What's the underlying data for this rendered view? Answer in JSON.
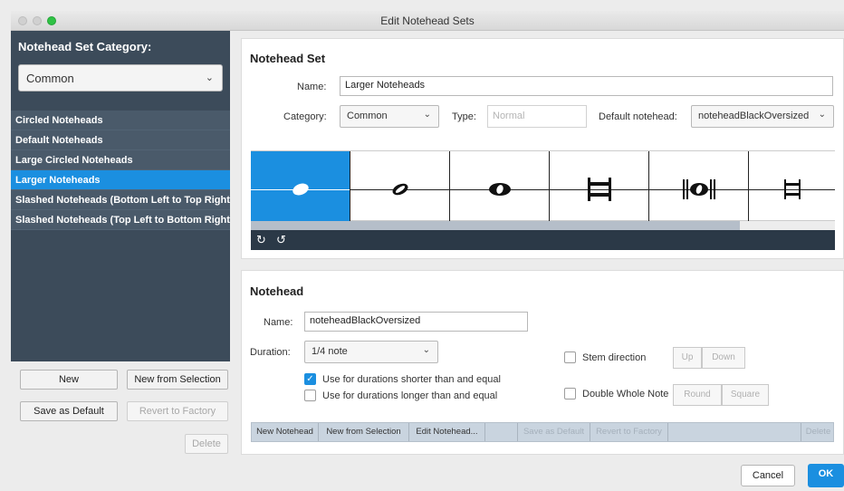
{
  "window": {
    "title": "Edit Notehead Sets"
  },
  "sidebar": {
    "category_label": "Notehead Set Category:",
    "category_value": "Common",
    "items": [
      {
        "label": "Circled Noteheads",
        "selected": false
      },
      {
        "label": "Default Noteheads",
        "selected": false
      },
      {
        "label": "Large Circled Noteheads",
        "selected": false
      },
      {
        "label": "Larger Noteheads",
        "selected": true
      },
      {
        "label": "Slashed Noteheads (Bottom Left to Top Right)",
        "selected": false
      },
      {
        "label": "Slashed Noteheads (Top Left to Bottom Right)",
        "selected": false
      }
    ],
    "buttons": {
      "new": "New",
      "new_from_selection": "New from Selection",
      "save_as_default": "Save as Default",
      "revert_to_factory": "Revert to Factory",
      "delete": "Delete"
    }
  },
  "notehead_set": {
    "title": "Notehead Set",
    "name_label": "Name:",
    "name_value": "Larger Noteheads",
    "category_label": "Category:",
    "category_value": "Common",
    "type_label": "Type:",
    "type_value": "Normal",
    "default_label": "Default notehead:",
    "default_value": "noteheadBlackOversized"
  },
  "notehead": {
    "title": "Notehead",
    "name_label": "Name:",
    "name_value": "noteheadBlackOversized",
    "duration_label": "Duration:",
    "duration_value": "1/4 note",
    "shorter_label": "Use for durations shorter than and equal",
    "longer_label": "Use for durations longer than and equal",
    "stem_label": "Stem direction",
    "stem_up": "Up",
    "stem_down": "Down",
    "dwn_label": "Double Whole Note",
    "dwn_round": "Round",
    "dwn_square": "Square"
  },
  "bottom_toolbar": {
    "new_notehead": "New Notehead",
    "new_from_selection": "New from Selection",
    "edit_notehead": "Edit Notehead...",
    "save_as_default": "Save as Default",
    "revert_to_factory": "Revert to Factory",
    "delete": "Delete"
  },
  "dialog": {
    "cancel": "Cancel",
    "ok": "OK"
  },
  "colors": {
    "accent": "#1b8fe0",
    "sidebar": "#3c4b5a"
  }
}
